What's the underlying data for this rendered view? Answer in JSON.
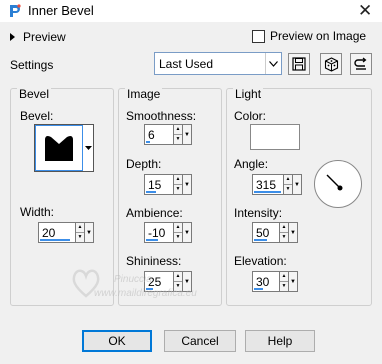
{
  "window": {
    "title": "Inner Bevel",
    "close_glyph": "✕"
  },
  "preview": {
    "label": "Preview",
    "preview_on_image_label": "Preview on Image",
    "preview_on_image_checked": false
  },
  "settings": {
    "label": "Settings",
    "selected": "Last Used"
  },
  "groups": {
    "bevel": {
      "title": "Bevel",
      "bevel_label": "Bevel:",
      "width_label": "Width:",
      "width_value": "20"
    },
    "image": {
      "title": "Image",
      "smoothness_label": "Smoothness:",
      "smoothness_value": "6",
      "depth_label": "Depth:",
      "depth_value": "15",
      "ambience_label": "Ambience:",
      "ambience_value": "-10",
      "shininess_label": "Shininess:",
      "shininess_value": "25"
    },
    "light": {
      "title": "Light",
      "color_label": "Color:",
      "color_value": "#ffffff",
      "angle_label": "Angle:",
      "angle_value": "315",
      "intensity_label": "Intensity:",
      "intensity_value": "50",
      "elevation_label": "Elevation:",
      "elevation_value": "30"
    }
  },
  "buttons": {
    "ok": "OK",
    "cancel": "Cancel",
    "help": "Help"
  },
  "watermark": {
    "line1": "Pinuccia",
    "line2": "www.maildiregrafica.eu"
  },
  "colors": {
    "accent": "#3c8ee8",
    "dialog_bg": "#f0f0f0"
  }
}
